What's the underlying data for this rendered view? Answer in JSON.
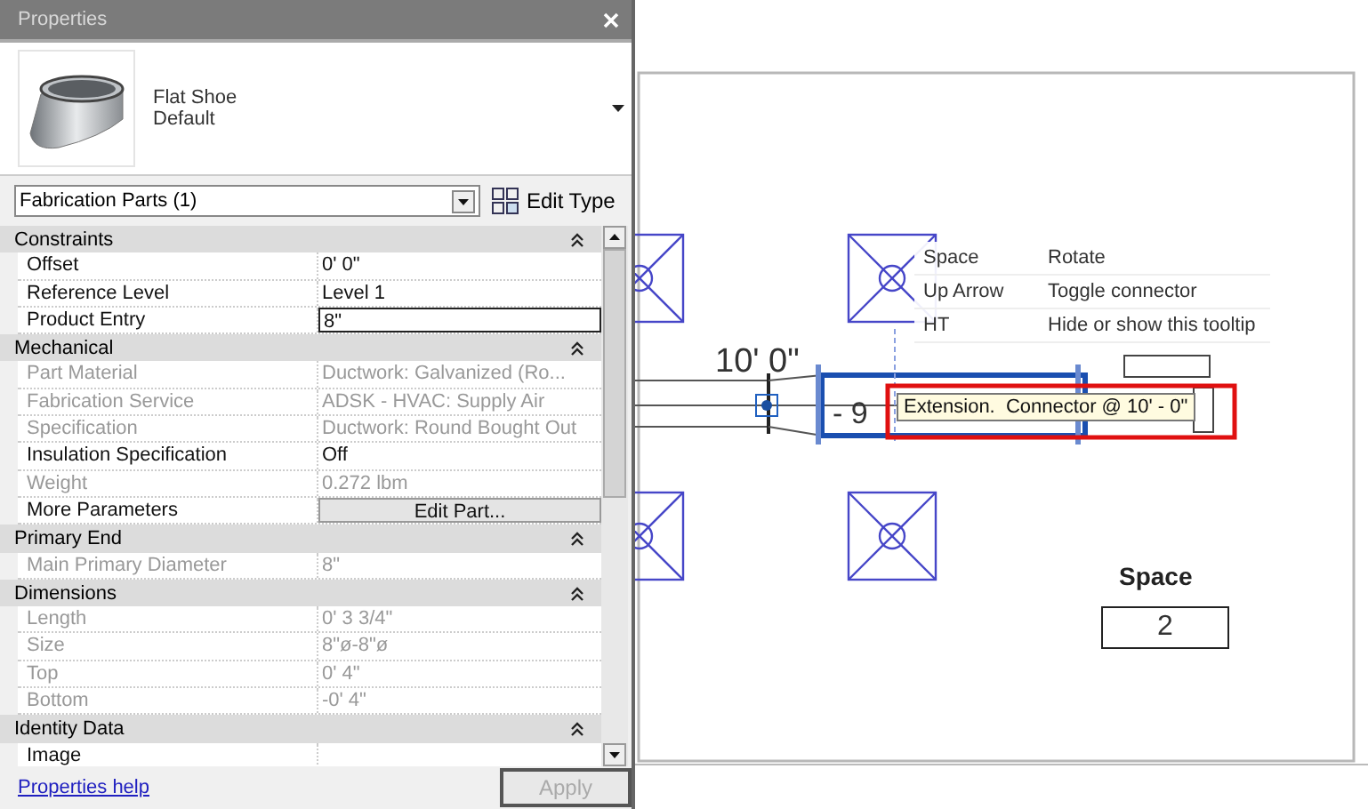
{
  "properties": {
    "title": "Properties",
    "type_name": "Flat Shoe",
    "type_sub": "Default",
    "selector": "Fabrication Parts (1)",
    "edit_type": "Edit Type",
    "groups": [
      {
        "name": "Constraints",
        "expanded": true,
        "rows": [
          {
            "label": "Offset",
            "value": "0'  0\"",
            "kind": "text",
            "disabled": false
          },
          {
            "label": "Reference Level",
            "value": "Level 1",
            "kind": "text",
            "disabled": false
          },
          {
            "label": "Product Entry",
            "value": "8\"",
            "kind": "field",
            "disabled": false
          }
        ]
      },
      {
        "name": "Mechanical",
        "expanded": true,
        "rows": [
          {
            "label": "Part Material",
            "value": "Ductwork: Galvanized (Ro...",
            "kind": "text",
            "disabled": true
          },
          {
            "label": "Fabrication Service",
            "value": "ADSK - HVAC: Supply Air",
            "kind": "text",
            "disabled": true
          },
          {
            "label": "Specification",
            "value": "Ductwork: Round Bought Out",
            "kind": "text",
            "disabled": true
          },
          {
            "label": "Insulation Specification",
            "value": "Off",
            "kind": "text",
            "disabled": false
          },
          {
            "label": "Weight",
            "value": "0.272 lbm",
            "kind": "text",
            "disabled": true
          },
          {
            "label": "More Parameters",
            "value": "Edit Part...",
            "kind": "button",
            "disabled": false
          }
        ]
      },
      {
        "name": "Primary End",
        "expanded": true,
        "rows": [
          {
            "label": "Main Primary Diameter",
            "value": "8\"",
            "kind": "text",
            "disabled": true
          }
        ]
      },
      {
        "name": "Dimensions",
        "expanded": true,
        "rows": [
          {
            "label": "Length",
            "value": "0'  3 3/4\"",
            "kind": "text",
            "disabled": true
          },
          {
            "label": "Size",
            "value": "8\"ø-8\"ø",
            "kind": "text",
            "disabled": true
          },
          {
            "label": "Top",
            "value": "0'  4\"",
            "kind": "text",
            "disabled": true
          },
          {
            "label": "Bottom",
            "value": "-0'  4\"",
            "kind": "text",
            "disabled": true
          }
        ]
      },
      {
        "name": "Identity Data",
        "expanded": true,
        "rows": [
          {
            "label": "Image",
            "kind": "text",
            "disabled": false
          }
        ]
      }
    ],
    "help_link": "Properties help",
    "apply": {
      "label": "Apply",
      "disabled": true
    }
  },
  "canvas": {
    "dimension": "10'  0\"",
    "partial_dimension": "- 9",
    "shortcuts": [
      {
        "key": "Space",
        "action": "Rotate"
      },
      {
        "key": "Up Arrow",
        "action": "Toggle connector"
      },
      {
        "key": "HT",
        "action": "Hide or show this tooltip"
      }
    ],
    "tooltip": "Extension.  Connector @ 10' - 0\"",
    "space_tag": {
      "label": "Space",
      "number": "2"
    }
  }
}
